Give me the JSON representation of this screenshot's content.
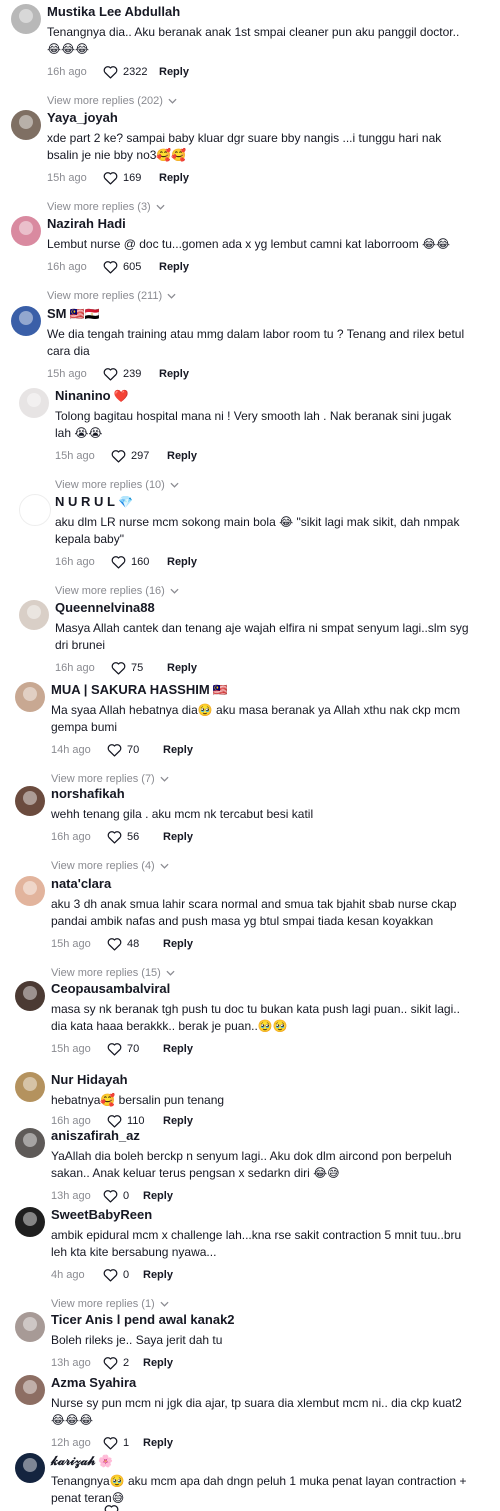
{
  "comments": [
    {
      "user": "Mustika Lee Abdullah",
      "badge": "",
      "text": "Tenangnya dia.. Aku beranak anak 1st smpai cleaner pun aku panggil doctor.. 😂😂😂",
      "time": "16h ago",
      "likes": "2322",
      "reply": "Reply",
      "more": "View more replies (202)",
      "avatar_color": "#b8b8b8"
    },
    {
      "user": "Yaya_joyah",
      "badge": "",
      "text": "xde part 2 ke? sampai baby kluar dgr suare bby nangis ...i tunggu hari nak bsalin je nie bby no3🥰🥰",
      "time": "15h ago",
      "likes": "169",
      "reply": "Reply",
      "more": "View more replies (3)",
      "avatar_color": "#7f6f63"
    },
    {
      "user": "Nazirah Hadi",
      "badge": "",
      "text": "Lembut nurse @ doc tu...gomen ada x yg lembut camni kat laborroom 😂😂",
      "time": "16h ago",
      "likes": "605",
      "reply": "Reply",
      "more": "View more replies (211)",
      "avatar_color": "#d98aa0"
    },
    {
      "user": "SM",
      "badge": "🇲🇾🇪🇬",
      "text": "We dia tengah training atau mmg dalam labor room tu ? Tenang and rilex betul cara dia",
      "time": "15h ago",
      "likes": "239",
      "reply": "Reply",
      "more": "",
      "avatar_color": "#3a5fa8"
    },
    {
      "user": "Ninanino",
      "badge": "❤️",
      "text": "Tolong bagitau hospital mana ni ! Very smooth lah . Nak beranak sini jugak lah 😭😭",
      "time": "15h ago",
      "likes": "297",
      "reply": "Reply",
      "more": "View more replies (10)",
      "avatar_color": "#e7e4e4"
    },
    {
      "user": "N U R U L",
      "badge": "💎",
      "text": "aku dlm LR nurse mcm sokong main bola 😂 \"sikit lagi mak sikit, dah nmpak kepala baby\"",
      "time": "16h ago",
      "likes": "160",
      "reply": "Reply",
      "more": "View more replies (16)",
      "avatar_color": "#ffffff"
    },
    {
      "user": "Queennelvina88",
      "badge": "",
      "text": "Masya Allah cantek dan tenang aje wajah elfira ni smpat senyum lagi..slm syg dri brunei",
      "time": "16h ago",
      "likes": "75",
      "reply": "Reply",
      "more": "",
      "avatar_color": "#d9cfc7"
    },
    {
      "user": "MUA | SAKURA HASSHIM",
      "badge": "🇲🇾",
      "text": "Ma syaa Allah hebatnya dia🥹 aku masa beranak ya Allah xthu nak ckp mcm gempa bumi",
      "time": "14h ago",
      "likes": "70",
      "reply": "Reply",
      "more": "View more replies (7)",
      "avatar_color": "#c8a892"
    },
    {
      "user": "norshafikah",
      "badge": "",
      "text": "wehh tenang gila . aku mcm nk tercabut besi katil",
      "time": "16h ago",
      "likes": "56",
      "reply": "Reply",
      "more": "View more replies (4)",
      "avatar_color": "#6b4b3e"
    },
    {
      "user": "nata'clara",
      "badge": "",
      "text": "aku 3 dh anak smua lahir scara normal and smua tak bjahit sbab nurse ckap pandai ambik nafas and push masa yg btul smpai tiada kesan koyakkan",
      "time": "15h ago",
      "likes": "48",
      "reply": "Reply",
      "more": "View more replies (15)",
      "avatar_color": "#e2b49d"
    },
    {
      "user": "Ceopausambalviral",
      "badge": "",
      "text": "masa sy nk beranak tgh push tu doc tu bukan kata push lagi puan.. sikit lagi.. dia kata haaa berakkk.. berak je puan..🥹🥹",
      "time": "15h ago",
      "likes": "70",
      "reply": "Reply",
      "more": "",
      "avatar_color": "#4b3a33"
    },
    {
      "user": "Nur Hidayah",
      "badge": "",
      "text": "hebatnya🥰 bersalin pun tenang",
      "time": "16h ago",
      "likes": "110",
      "reply": "Reply",
      "more": "",
      "avatar_color": "#b4925e"
    },
    {
      "user": "aniszafirah_az",
      "badge": "",
      "text": "YaAllah dia boleh berckp n senyum lagi.. Aku dok dlm aircond pon berpeluh sakan.. Anak keluar terus pengsan x sedarkn diri 😂😅",
      "time": "13h ago",
      "likes": "0",
      "reply": "Reply",
      "more": "",
      "avatar_color": "#5e5a58"
    },
    {
      "user": "SweetBabyReen",
      "badge": "",
      "text": "ambik epidural mcm x challenge lah...kna rse sakit contraction 5 mnit tuu..bru leh kta kite bersabung nyawa...",
      "time": "4h ago",
      "likes": "0",
      "reply": "Reply",
      "more": "View more replies (1)",
      "avatar_color": "#1f1f1f"
    },
    {
      "user": "Ticer Anis l pend awal kanak2",
      "badge": "",
      "text": "Boleh rileks je.. Saya jerit dah tu",
      "time": "13h ago",
      "likes": "2",
      "reply": "Reply",
      "more": "",
      "avatar_color": "#a79a96"
    },
    {
      "user": "Azma Syahira",
      "badge": "",
      "text": "Nurse sy pun mcm ni jgk dia ajar, tp suara dia xlembut mcm ni.. dia ckp kuat2 😂😂😂",
      "time": "12h ago",
      "likes": "1",
      "reply": "Reply",
      "more": "",
      "avatar_color": "#8d6e63"
    },
    {
      "user": "𝓀𝒶𝓇𝒾𝓏𝒶𝒽",
      "badge": "🌸",
      "text": "Tenangnya🥹 aku mcm apa dah dngn peluh 1 muka penat layan contraction + penat teran😅",
      "time": "",
      "likes": "",
      "reply": "",
      "more": "",
      "avatar_color": "#14243f"
    }
  ],
  "icons": {
    "like": "heart-outline-icon",
    "expand": "chevron-down-icon"
  },
  "colors": {
    "text": "#161823",
    "muted": "#8a8b91",
    "background": "#ffffff"
  }
}
